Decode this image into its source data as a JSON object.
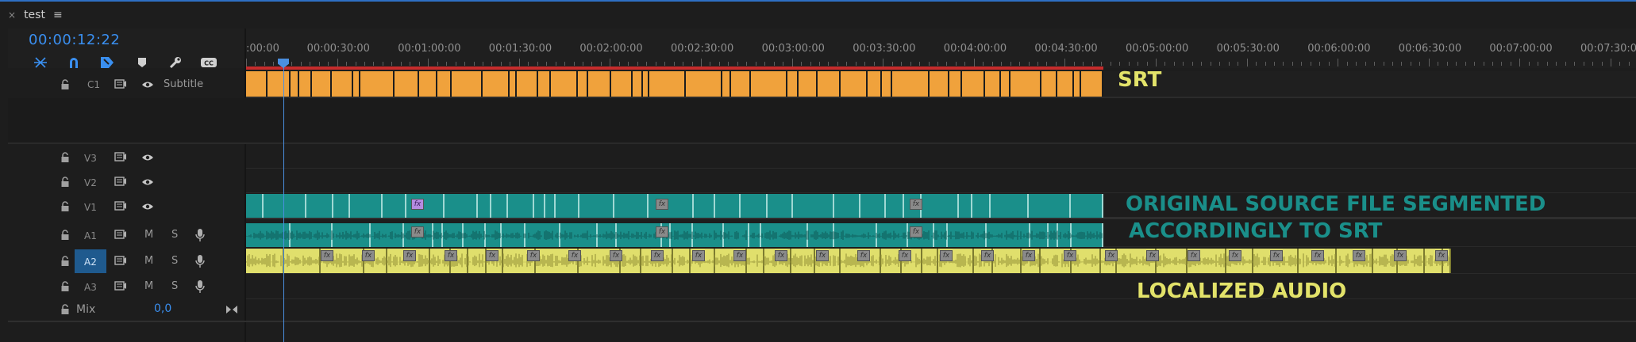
{
  "panel": {
    "close": "×",
    "title": "test",
    "menu": "≡"
  },
  "timecode": "00:00:12:22",
  "tools": [
    "snap-icon",
    "magnet-icon",
    "linked-selection-icon",
    "marker-icon",
    "wrench-icon",
    "captions-icon"
  ],
  "ruler_labels": [
    "00:00",
    "00:00:30:00",
    "00:01:00:00",
    "00:01:30:00",
    "00:02:00:00",
    "00:02:30:00",
    "00:03:00:00",
    "00:03:30:00",
    "00:04:00:00",
    "00:04:30:00",
    "00:05:00:00",
    "00:05:30:00",
    "00:06:00:00",
    "00:06:30:00",
    "00:07:00:00",
    "00:07:30:00"
  ],
  "ruler_first_prefix": ":",
  "tracks": {
    "c1": {
      "name": "C1",
      "label": "Subtitle"
    },
    "v3": {
      "name": "V3"
    },
    "v2": {
      "name": "V2"
    },
    "v1": {
      "name": "V1"
    },
    "a1": {
      "name": "A1",
      "m": "M",
      "s": "S"
    },
    "a2": {
      "name": "A2",
      "m": "M",
      "s": "S"
    },
    "a3": {
      "name": "A3",
      "m": "M",
      "s": "S"
    },
    "mix": {
      "name": "Mix",
      "value": "0,0"
    }
  },
  "fx_label": "fx",
  "annotations": {
    "srt": "SRT",
    "original_line1": "ORIGINAL SOURCE FILE SEGMENTED",
    "original_line2": "ACCORDINGLY TO SRT",
    "localized": "LOCALIZED AUDIO"
  },
  "colors": {
    "subtitle_clip": "#f0a23c",
    "video_clip": "#1a8f8a",
    "audio_clip": "#1a8f8a",
    "localized_clip": "#e0df6c",
    "annotation_yellow": "#e3e36a",
    "annotation_teal": "#1a8f8a",
    "playhead": "#4a8fe0",
    "timecode": "#3a8ff0"
  }
}
